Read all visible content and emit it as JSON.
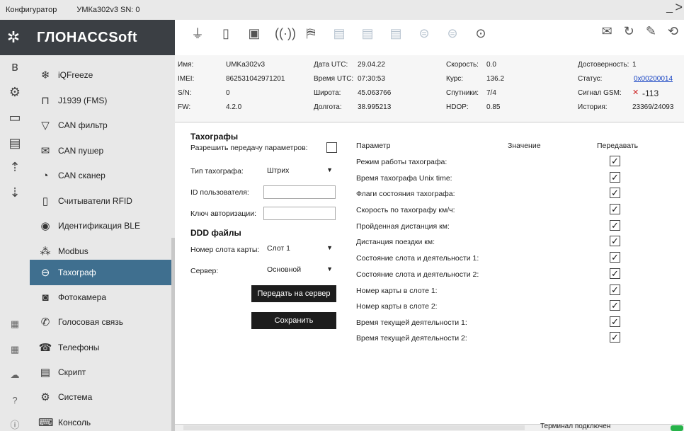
{
  "titlebar": {
    "app": "Конфигуратор",
    "device": "УМКа302v3 SN: 0",
    "minimize": "_",
    "chevron": ">"
  },
  "brand": {
    "name": "ГЛОНАССSoft"
  },
  "toolbar_icons": [
    "plug-icon",
    "battery-icon",
    "sim-icon",
    "signal-icon",
    "map-icon",
    "card-icon",
    "card-dim-icon",
    "card-dim-icon",
    "db-icon",
    "db-icon",
    "location-icon"
  ],
  "toolbar_right": [
    "sms-icon",
    "refresh-icon",
    "tools-icon",
    "rotate-icon"
  ],
  "rail_icons": [
    "bluetooth-icon",
    "chip-icon",
    "folder-icon",
    "save-icon",
    "upload-icon",
    "download-icon",
    "doc-icon",
    "grid-icon",
    "cloud-icon",
    "help-icon",
    "info-icon"
  ],
  "sidebar": {
    "items": [
      {
        "label": "iQFreeze",
        "icon": "snowflake-icon"
      },
      {
        "label": "J1939 (FMS)",
        "icon": "j1939-icon"
      },
      {
        "label": "CAN фильтр",
        "icon": "filter-icon"
      },
      {
        "label": "CAN пушер",
        "icon": "can-push-icon"
      },
      {
        "label": "CAN сканер",
        "icon": "can-scan-icon"
      },
      {
        "label": "Считыватели RFID",
        "icon": "rfid-icon"
      },
      {
        "label": "Идентификация BLE",
        "icon": "ble-icon"
      },
      {
        "label": "Modbus",
        "icon": "modbus-icon"
      },
      {
        "label": "Тахограф",
        "icon": "tacho-icon"
      },
      {
        "label": "Фотокамера",
        "icon": "camera-icon"
      },
      {
        "label": "Голосовая связь",
        "icon": "phone-icon"
      },
      {
        "label": "Телефоны",
        "icon": "phonebook-icon"
      },
      {
        "label": "Скрипт",
        "icon": "script-icon"
      },
      {
        "label": "Система",
        "icon": "system-icon"
      },
      {
        "label": "Консоль",
        "icon": "console-icon"
      }
    ]
  },
  "info": {
    "name_label": "Имя:",
    "name": "UMKa302v3",
    "imei_label": "IMEI:",
    "imei": "862531042971201",
    "sn_label": "S/N:",
    "sn": "0",
    "fw_label": "FW:",
    "fw": "4.2.0",
    "date_label": "Дата UTC:",
    "date": "29.04.22",
    "time_label": "Время UTC:",
    "time": "07:30:53",
    "lat_label": "Широта:",
    "lat": "45.063766",
    "lon_label": "Долгота:",
    "lon": "38.995213",
    "speed_label": "Скорость:",
    "speed": "0.0",
    "course_label": "Курс:",
    "course": "136.2",
    "sat_label": "Спутники:",
    "sat": "7/4",
    "hdop_label": "HDOP:",
    "hdop": "0.85",
    "valid_label": "Достоверность:",
    "valid": "1",
    "status_label": "Статус:",
    "status": "0x00200014",
    "gsm_label": "Сигнал GSM:",
    "gsm": "-113",
    "history_label": "История:",
    "history": "23369/24093"
  },
  "tacho": {
    "title": "Тахографы",
    "allow_label": "Разрешить передачу параметров:",
    "type_label": "Тип тахографа:",
    "type_value": "Штрих",
    "uid_label": "ID пользователя:",
    "uid_value": "",
    "key_label": "Ключ авторизации:",
    "key_value": "",
    "ddd_title": "DDD файлы",
    "slot_label": "Номер слота карты:",
    "slot_value": "Слот 1",
    "server_label": "Сервер:",
    "server_value": "Основной",
    "send_button": "Передать на сервер",
    "save_button": "Сохранить"
  },
  "params": {
    "col_param": "Параметр",
    "col_value": "Значение",
    "col_send": "Передавать",
    "rows": [
      "Режим работы тахографа:",
      "Время тахографа Unix time:",
      "Флаги состояния тахографа:",
      "Скорость по тахографу км/ч:",
      "Пройденная дистанция км:",
      "Дистанция поездки км:",
      "Состояние слота и деятельности 1:",
      "Состояние слота и деятельности 2:",
      "Номер карты в слоте 1:",
      "Номер карты в слоте 2:",
      "Время текущей деятельности 1:",
      "Время текущей деятельности 2:"
    ],
    "checked": "✓"
  },
  "status": {
    "text": "Терминал подключен"
  }
}
